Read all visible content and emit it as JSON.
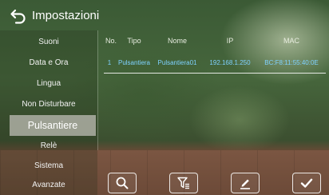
{
  "header": {
    "title": "Impostazioni",
    "back_icon": "back-arrow-icon"
  },
  "sidebar": {
    "items": [
      {
        "label": "Suoni",
        "selected": false
      },
      {
        "label": "Data e Ora",
        "selected": false
      },
      {
        "label": "Lingua",
        "selected": false
      },
      {
        "label": "Non Disturbare",
        "selected": false
      },
      {
        "label": "Pulsantiere",
        "selected": true
      },
      {
        "label": "Relè",
        "selected": false
      },
      {
        "label": "Sistema",
        "selected": false
      },
      {
        "label": "Avanzate",
        "selected": false
      }
    ]
  },
  "table": {
    "headers": [
      "No.",
      "Tipo",
      "Nome",
      "IP",
      "MAC"
    ],
    "rows": [
      [
        "1",
        "Pulsantiera",
        "Pulsantiera01",
        "192.168.1.250",
        "BC:F8:11:55:40:0E"
      ]
    ],
    "row_text_color": "#7fd2ff"
  },
  "toolbar": {
    "buttons": [
      {
        "icon": "search-icon"
      },
      {
        "icon": "filter-icon"
      },
      {
        "icon": "edit-icon"
      },
      {
        "icon": "check-icon"
      }
    ]
  }
}
